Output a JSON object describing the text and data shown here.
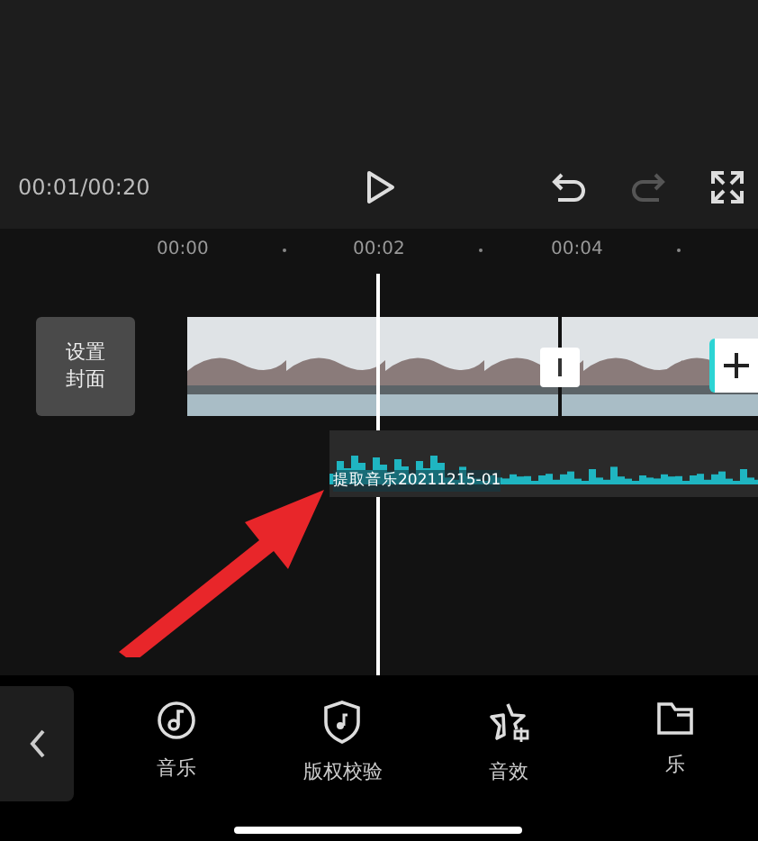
{
  "player": {
    "time": "00:01/00:20",
    "redo_disabled": true
  },
  "ruler": [
    "00:00",
    "00:02",
    "00:04"
  ],
  "cover": {
    "lines": [
      "设置",
      "封面"
    ]
  },
  "audio_clip": {
    "label": "提取音乐20211215-01"
  },
  "tools": [
    {
      "kind": "music",
      "label": "音乐"
    },
    {
      "kind": "copyright",
      "label": "版权校验"
    },
    {
      "kind": "effect",
      "label": "音效"
    },
    {
      "kind": "folder",
      "label": "乐"
    }
  ]
}
